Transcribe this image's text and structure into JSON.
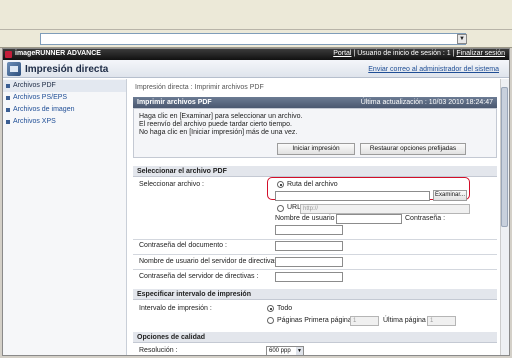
{
  "browser": {
    "address_value": "",
    "dropdown_glyph": "▼"
  },
  "header": {
    "brand": "imageRUNNER ADVANCE",
    "portal_link": "Portal",
    "separator": "|",
    "login_user": "Usuario de inicio de sesión : 1",
    "logout_link": "Finalizar sesión",
    "app_title": "Impresión directa",
    "send_admin_link": "Enviar correo al administrador del sistema"
  },
  "sidebar": {
    "items": [
      {
        "label": "Archivos PDF",
        "active": true
      },
      {
        "label": "Archivos PS/EPS",
        "active": false
      },
      {
        "label": "Archivos de imagen",
        "active": false
      },
      {
        "label": "Archivos XPS",
        "active": false
      }
    ]
  },
  "main": {
    "breadcrumb": "Impresión directa : Imprimir archivos PDF",
    "panel_title": "Imprimir archivos PDF",
    "last_update": "Última actualización : 10/03 2010 18:24:47",
    "notes": [
      "Haga clic en [Examinar] para seleccionar un archivo.",
      "El reenvío del archivo puede tardar cierto tiempo.",
      "No haga clic en [Iniciar impresión] más de una vez."
    ],
    "start_print_button": "Iniciar impresión",
    "restore_button": "Restaurar opciones prefijadas",
    "select_pdf_section": "Seleccionar el archivo PDF",
    "select_file_label": "Seleccionar archivo :",
    "file_path_option": "Ruta del archivo",
    "file_path_value": "",
    "browse_button": "Examinar...",
    "url_option": "URL",
    "url_placeholder": "http://",
    "username_label": "Nombre de usuario :",
    "username_value": "",
    "password_label": "Contraseña :",
    "password_value": "",
    "doc_password_label": "Contraseña del documento :",
    "doc_password_value": "",
    "policy_server_user_label": "Nombre de usuario del servidor de directivas :",
    "policy_server_user_value": "",
    "policy_server_password_label": "Contraseña del servidor de directivas :",
    "policy_server_password_value": "",
    "print_range_section": "Especificar intervalo de impresión",
    "print_range_label": "Intervalo de impresión :",
    "all_option": "Todo",
    "pages_option": "Páginas Primera página :",
    "first_page_value": "1",
    "last_page_label": "Última página :",
    "last_page_value": "1",
    "quality_section": "Opciones de calidad",
    "resolution_label": "Resolución :",
    "resolution_value": "600 ppp"
  },
  "colors": {
    "highlight": "#d20f2a",
    "section_bar": "#5a6a82",
    "link": "#1f4e96"
  }
}
